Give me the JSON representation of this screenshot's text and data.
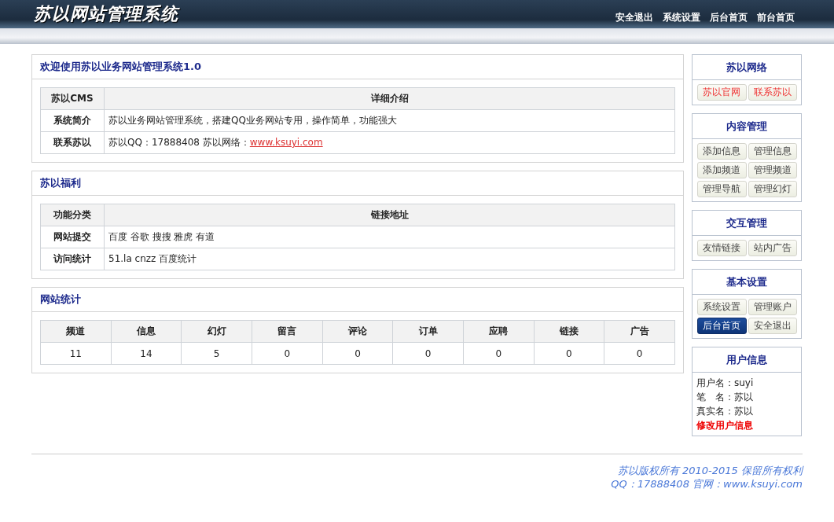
{
  "header": {
    "logo": "苏以网站管理系统",
    "nav": [
      "安全退出",
      "系统设置",
      "后台首页",
      "前台首页"
    ]
  },
  "panels": [
    {
      "title": "欢迎使用苏以业务网站管理系统1.0",
      "kind": "info",
      "head": [
        "苏以CMS",
        "详细介绍"
      ],
      "rows": [
        {
          "label": "系统简介",
          "text": "苏以业务网站管理系统，搭建QQ业务网站专用，操作简单，功能强大"
        },
        {
          "label": "联系苏以",
          "text": "苏以QQ：17888408 苏以网络：",
          "link": "www.ksuyi.com"
        }
      ]
    },
    {
      "title": "苏以福利",
      "kind": "info",
      "head": [
        "功能分类",
        "链接地址"
      ],
      "rows": [
        {
          "label": "网站提交",
          "text": "百度 谷歌 搜搜 雅虎 有道"
        },
        {
          "label": "访问统计",
          "text": "51.la cnzz 百度统计"
        }
      ]
    },
    {
      "title": "网站统计",
      "kind": "stats",
      "columns": [
        "频道",
        "信息",
        "幻灯",
        "留言",
        "评论",
        "订单",
        "应聘",
        "链接",
        "广告"
      ],
      "values": [
        "11",
        "14",
        "5",
        "0",
        "0",
        "0",
        "0",
        "0",
        "0"
      ]
    }
  ],
  "sidebar": [
    {
      "title": "苏以网络",
      "buttons": [
        {
          "label": "苏以官网",
          "kind": "red",
          "selected": false
        },
        {
          "label": "联系苏以",
          "kind": "red",
          "selected": false
        }
      ]
    },
    {
      "title": "内容管理",
      "buttons": [
        {
          "label": "添加信息",
          "kind": "plain",
          "selected": false
        },
        {
          "label": "管理信息",
          "kind": "plain",
          "selected": false
        },
        {
          "label": "添加频道",
          "kind": "plain",
          "selected": false
        },
        {
          "label": "管理频道",
          "kind": "plain",
          "selected": false
        },
        {
          "label": "管理导航",
          "kind": "plain",
          "selected": false
        },
        {
          "label": "管理幻灯",
          "kind": "plain",
          "selected": false
        }
      ]
    },
    {
      "title": "交互管理",
      "buttons": [
        {
          "label": "友情链接",
          "kind": "plain",
          "selected": false
        },
        {
          "label": "站内广告",
          "kind": "plain",
          "selected": false
        }
      ]
    },
    {
      "title": "基本设置",
      "buttons": [
        {
          "label": "系统设置",
          "kind": "plain",
          "selected": false
        },
        {
          "label": "管理账户",
          "kind": "plain",
          "selected": false
        },
        {
          "label": "后台首页",
          "kind": "plain",
          "selected": true
        },
        {
          "label": "安全退出",
          "kind": "plain",
          "selected": false
        }
      ]
    }
  ],
  "user_info": {
    "title": "用户信息",
    "lines": [
      "用户名：suyi",
      "笔　名：苏以",
      "真实名：苏以"
    ],
    "edit_link": "修改用户信息"
  },
  "footer": [
    "苏以版权所有 2010-2015 保留所有权利",
    "QQ：17888408 官网：www.ksuyi.com"
  ]
}
